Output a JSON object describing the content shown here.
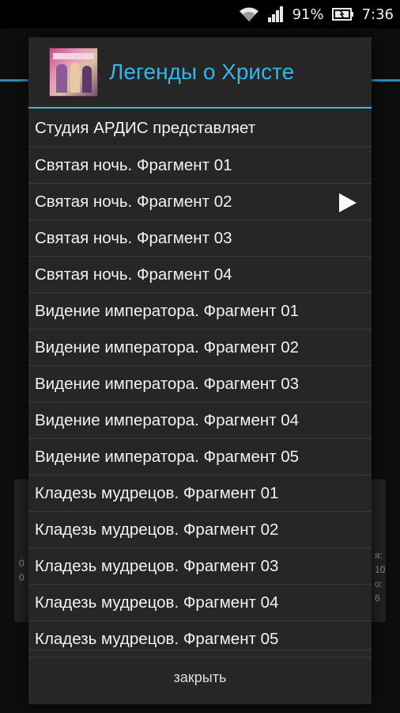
{
  "status_bar": {
    "battery_percent": "91%",
    "time": "7:36",
    "icons": [
      "wifi-icon",
      "signal-icon",
      "battery-icon"
    ]
  },
  "background": {
    "left_text": [
      "0",
      "0"
    ],
    "right_text": [
      "я:",
      "10",
      "о:",
      "6"
    ]
  },
  "dialog": {
    "title": "Легенды о Христе",
    "icon": "album-art-image",
    "accent_color": "#33b5e5",
    "tracks": [
      {
        "label": "Студия АРДИС представляет"
      },
      {
        "label": "Святая ночь. Фрагмент 01"
      },
      {
        "label": "Святая ночь. Фрагмент 02",
        "playing": true
      },
      {
        "label": "Святая ночь. Фрагмент 03"
      },
      {
        "label": "Святая ночь. Фрагмент 04"
      },
      {
        "label": "Видение императора. Фрагмент 01"
      },
      {
        "label": "Видение императора. Фрагмент 02"
      },
      {
        "label": "Видение императора. Фрагмент 03"
      },
      {
        "label": "Видение императора. Фрагмент 04"
      },
      {
        "label": "Видение императора. Фрагмент 05"
      },
      {
        "label": "Кладезь мудрецов. Фрагмент 01"
      },
      {
        "label": "Кладезь мудрецов. Фрагмент 02"
      },
      {
        "label": "Кладезь мудрецов. Фрагмент 03"
      },
      {
        "label": "Кладезь мудрецов. Фрагмент 04"
      },
      {
        "label": "Кладезь мудрецов. Фрагмент 05"
      }
    ],
    "close_label": "закрыть"
  }
}
